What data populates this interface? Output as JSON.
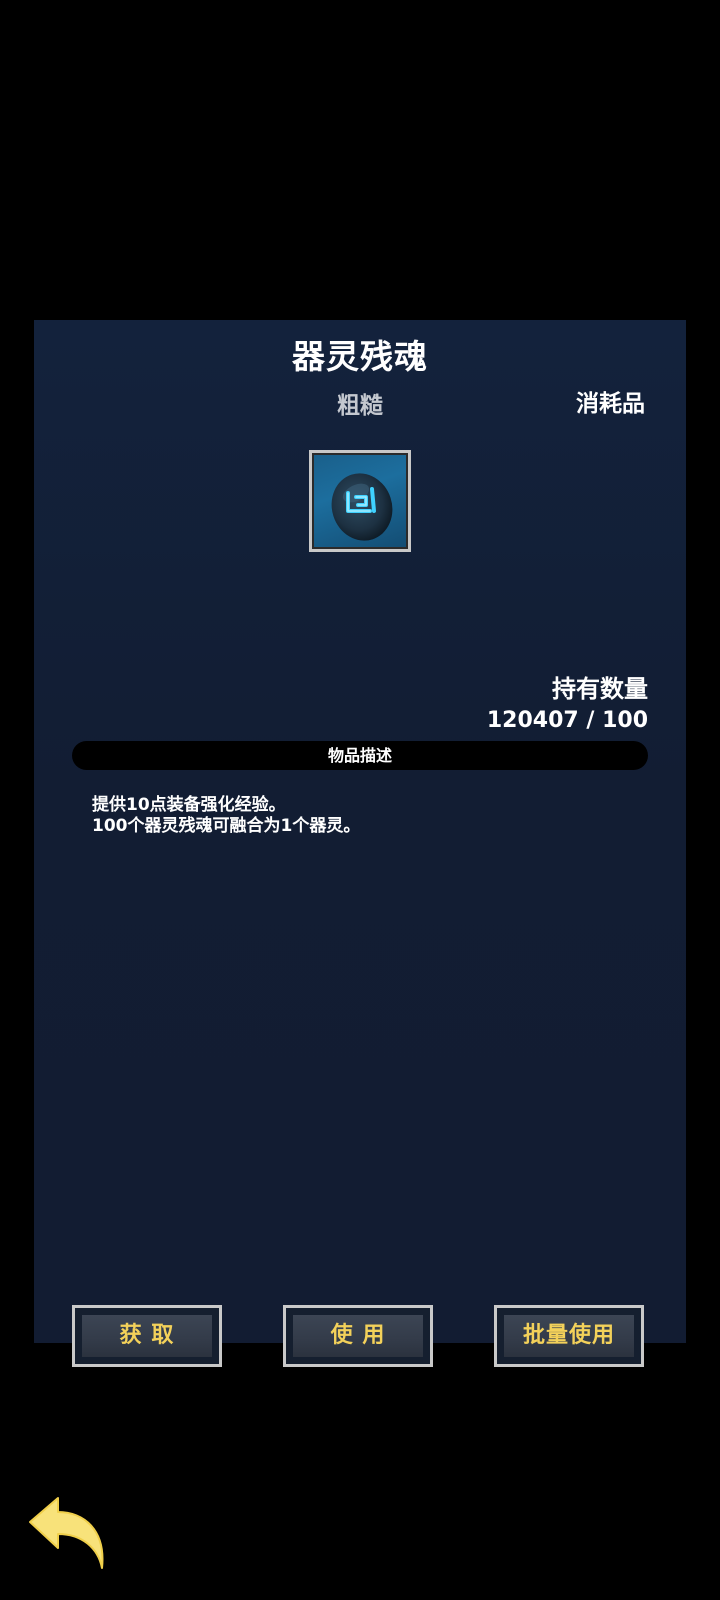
{
  "item": {
    "name": "器灵残魂",
    "quality": "粗糙",
    "category": "消耗品",
    "icon": "soul-rune-stone-icon"
  },
  "holdings": {
    "label": "持有数量",
    "count": "120407 / 100"
  },
  "description": {
    "header": "物品描述",
    "lines": [
      "提供10点装备强化经验。",
      "100个器灵残魂可融合为1个器灵。"
    ]
  },
  "buttons": {
    "get": "获 取",
    "use": "使 用",
    "batch_use": "批量使用"
  },
  "navigation": {
    "back_icon": "back-arrow-icon"
  },
  "colors": {
    "panel": "#121d33",
    "button_text": "#f3d15a",
    "back_arrow": "#f8e27a",
    "rune_glow": "#3fd2ff"
  }
}
